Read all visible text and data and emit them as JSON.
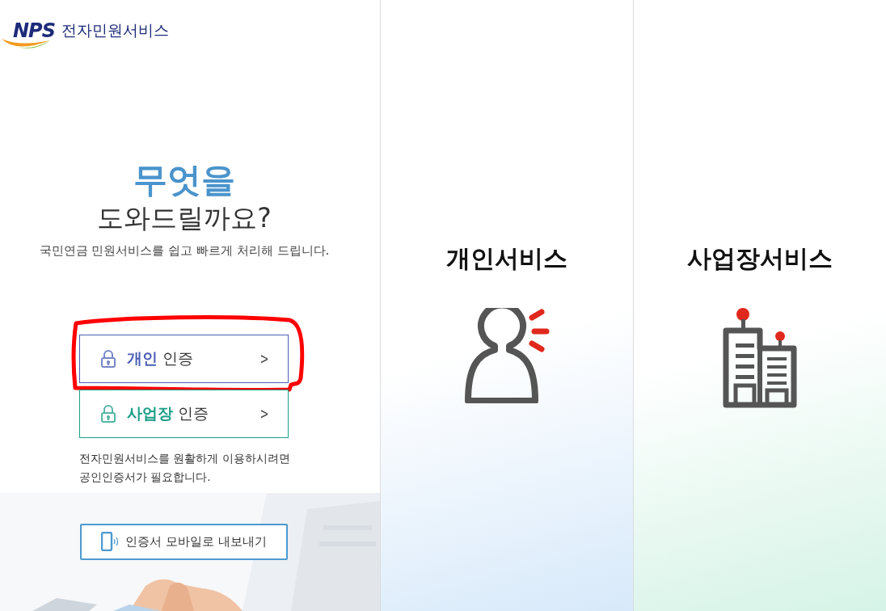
{
  "logo": {
    "mark": "NPS",
    "title": "전자민원서비스"
  },
  "intro": {
    "heading": "무엇을",
    "subheading": "도와드릴까요?",
    "description": "국민연금 민원서비스를 쉽고 빠르게 처리해 드립니다."
  },
  "auth_buttons": [
    {
      "label": "**개인** 인증",
      "arrow": ">",
      "color": "#4c5fb5",
      "highlighted": true
    },
    {
      "label": "**사업장** 인증",
      "arrow": ">",
      "color": "#1a9e86",
      "highlighted": false
    }
  ],
  "note": "전자민원서비스를 원활하게 이용하시려면\n공인인증서가 필요합니다.",
  "export_button": {
    "label": "인증서 모바일로 내보내기"
  },
  "services": [
    {
      "title": "개인서비스",
      "kind": "person",
      "color": "#d7e9fa"
    },
    {
      "title": "사업장서비스",
      "kind": "building",
      "color": "#d5f3e6"
    }
  ]
}
